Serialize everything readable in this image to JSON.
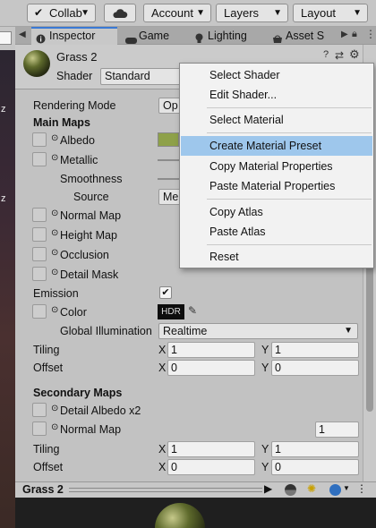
{
  "toolbar": {
    "collab": "Collab",
    "account": "Account",
    "layers": "Layers",
    "layout": "Layout"
  },
  "tabs": [
    "Inspector",
    "Game",
    "Lighting",
    "Asset S"
  ],
  "scene_text": [
    "z",
    "z"
  ],
  "material": {
    "name": "Grass 2",
    "shader_label": "Shader",
    "shader_value": "Standard"
  },
  "properties": {
    "rendering_mode_label": "Rendering Mode",
    "rendering_mode_value": "Op",
    "main_maps": "Main Maps",
    "albedo": "Albedo",
    "albedo_color": "#8ea149",
    "metallic": "Metallic",
    "smoothness": "Smoothness",
    "source": "Source",
    "source_value": "Me",
    "normal_map": "Normal Map",
    "height_map": "Height Map",
    "occlusion": "Occlusion",
    "detail_mask": "Detail Mask",
    "emission": "Emission",
    "emission_check": "✔",
    "color": "Color",
    "hdr": "HDR",
    "gi_label": "Global Illumination",
    "gi_value": "Realtime",
    "tiling": "Tiling",
    "offset": "Offset",
    "tiling_x": "1",
    "tiling_y": "1",
    "offset_x": "0",
    "offset_y": "0",
    "secondary_maps": "Secondary Maps",
    "detail_albedo": "Detail Albedo x2",
    "normal_map2": "Normal Map",
    "normal_map2_value": "1",
    "tiling2_x": "1",
    "tiling2_y": "1",
    "offset2_x": "0",
    "offset2_y": "0",
    "x_label": "X",
    "y_label": "Y"
  },
  "preview": {
    "name": "Grass 2"
  },
  "context_menu": {
    "items": [
      "Select Shader",
      "Edit Shader...",
      "Select Material",
      "Create Material Preset",
      "Copy Material Properties",
      "Paste Material Properties",
      "Copy Atlas",
      "Paste Atlas",
      "Reset"
    ],
    "highlighted": "Create Material Preset"
  }
}
